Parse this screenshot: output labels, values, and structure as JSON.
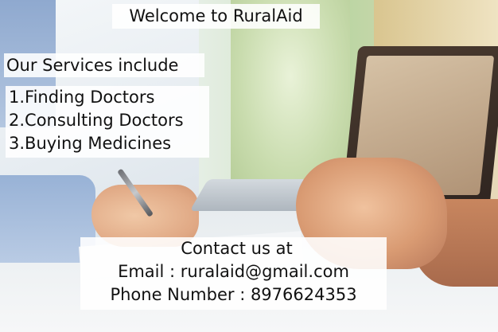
{
  "header": {
    "welcome_text": "Welcome to RuralAid"
  },
  "services": {
    "heading": "Our Services include",
    "items": [
      "1.Finding Doctors",
      "2.Consulting Doctors",
      "3.Buying Medicines"
    ]
  },
  "contact": {
    "heading": "Contact us at",
    "email_line": "Email : ruralaid@gmail.com",
    "phone_line": "Phone Number : 8976624353"
  }
}
